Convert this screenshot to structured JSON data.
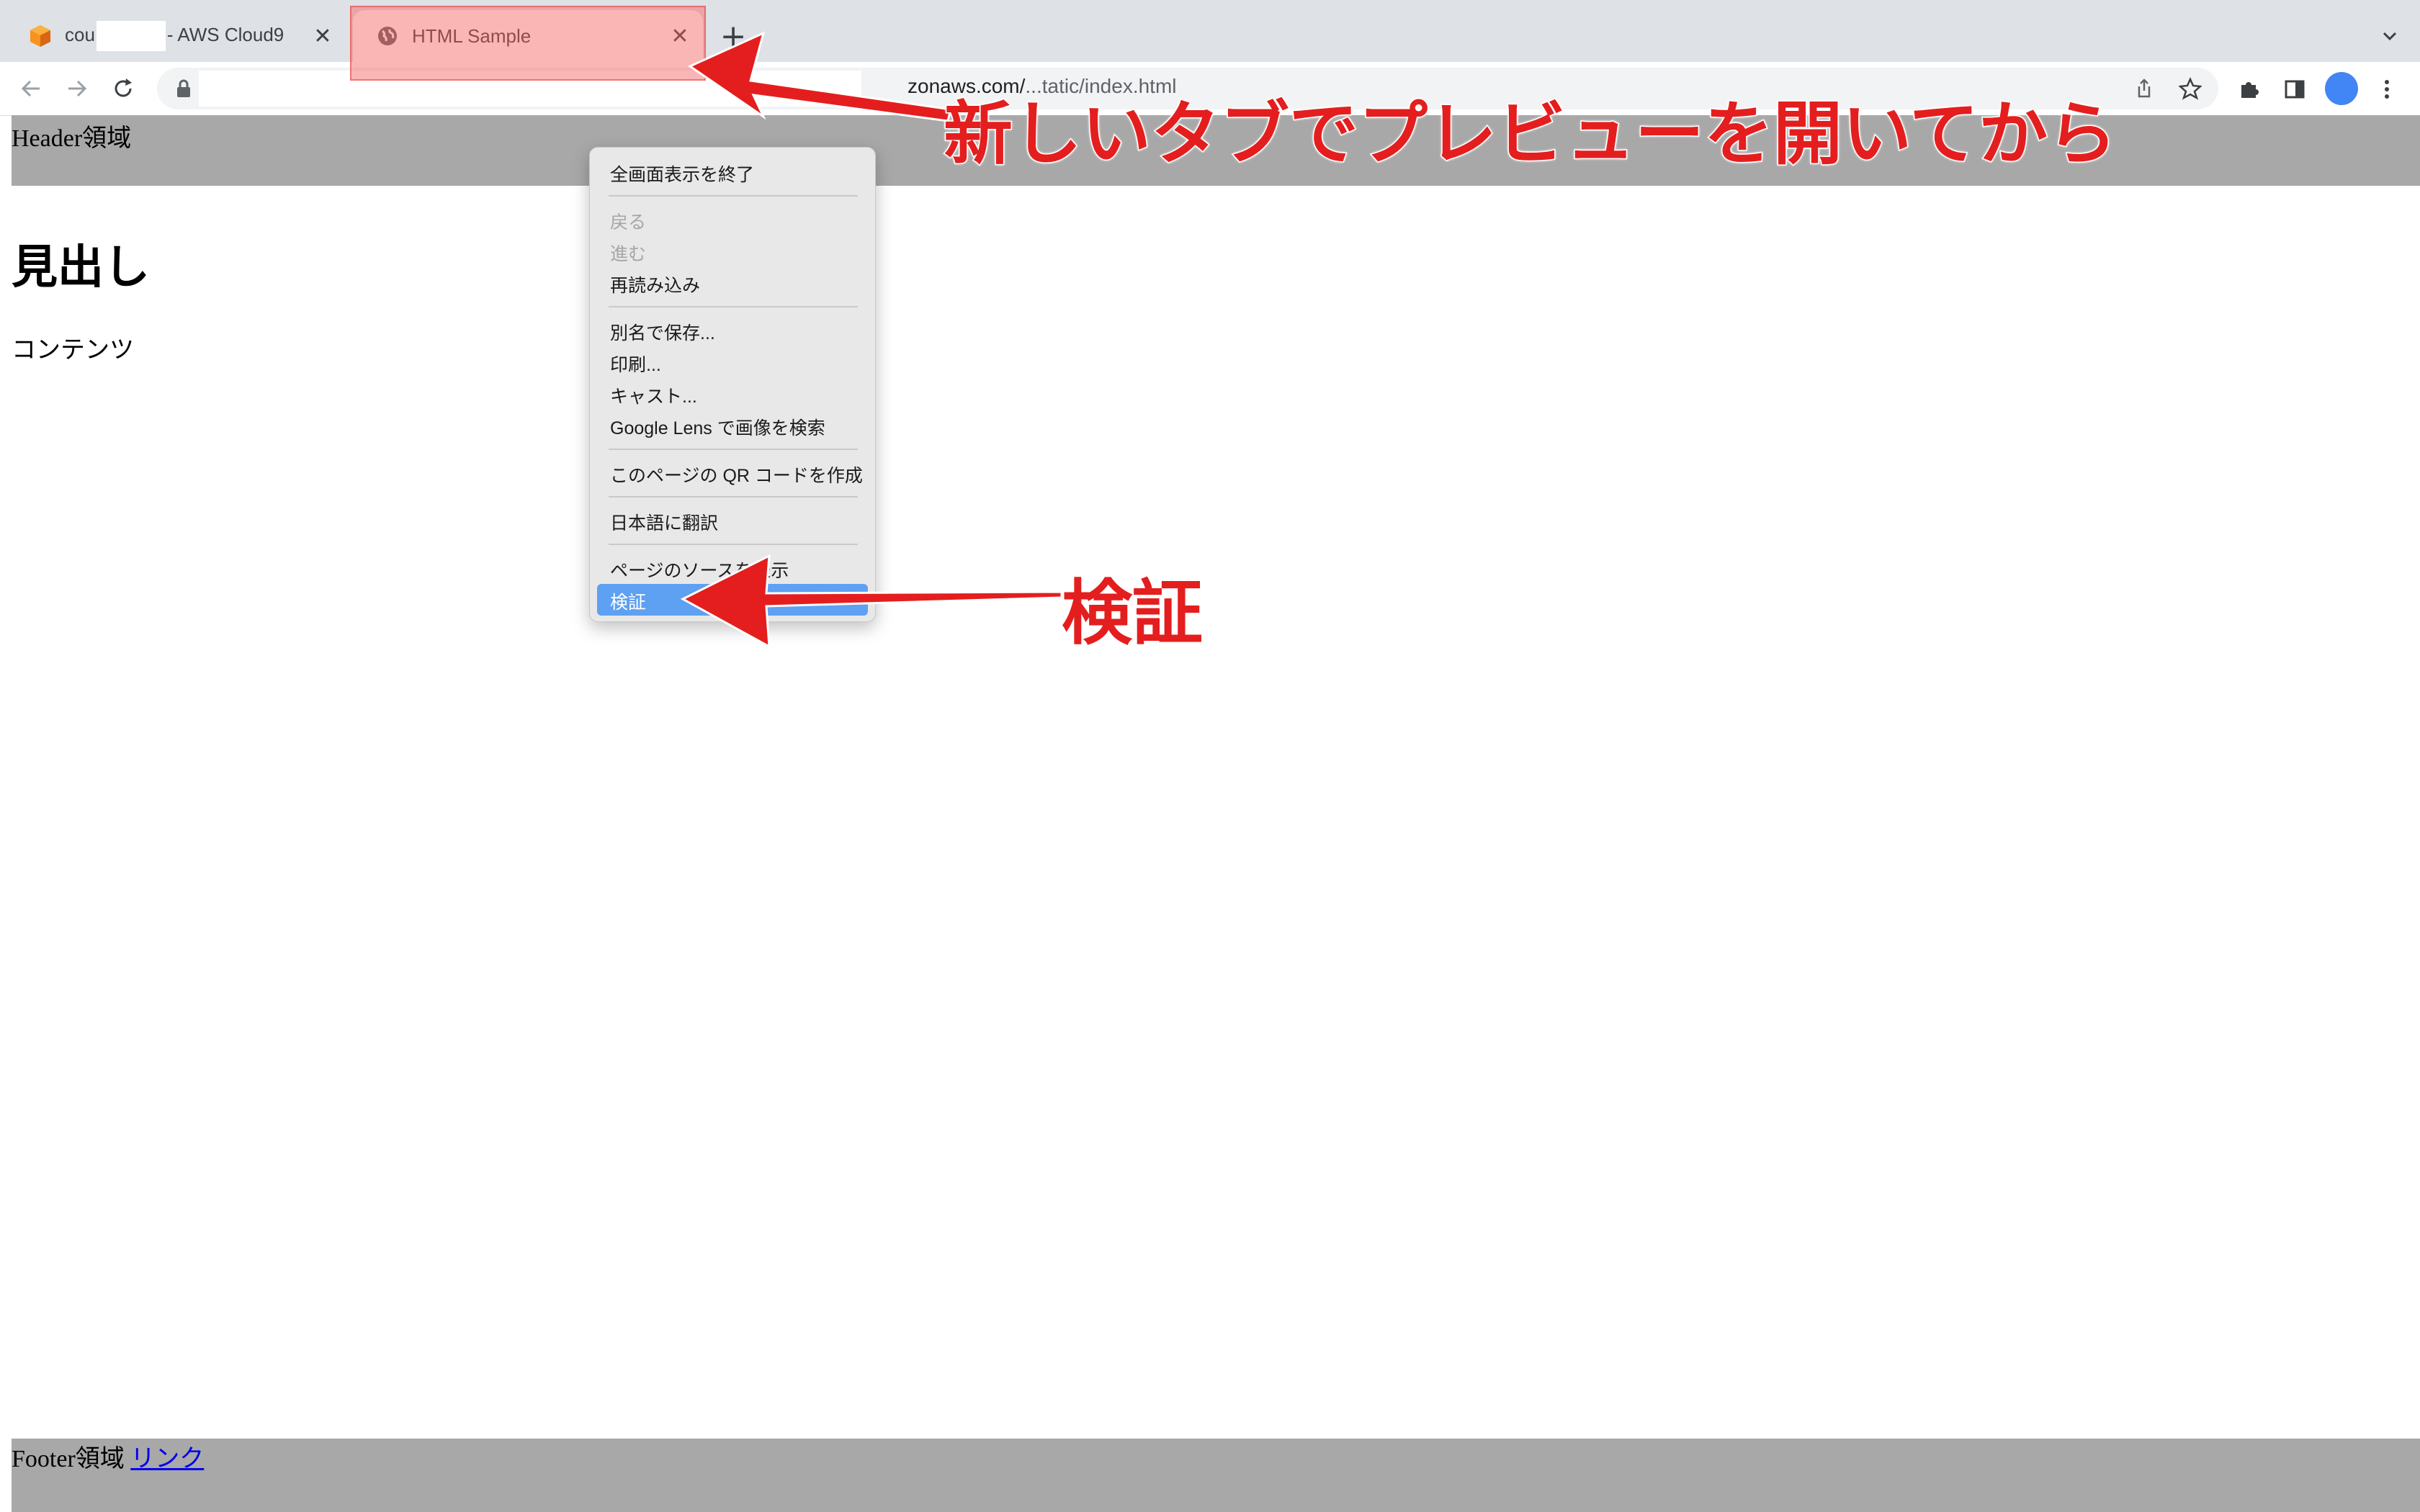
{
  "browser": {
    "tabs": [
      {
        "label_prefix": "cou",
        "label_suffix": "- AWS Cloud9",
        "icon": "cloud9-cube-icon",
        "active": false
      },
      {
        "label": "HTML Sample",
        "icon": "globe-icon",
        "active": true
      }
    ],
    "address_bar": {
      "url_host": "zonaws.com/",
      "url_path": "...tatic/index.html"
    }
  },
  "page": {
    "header_text": "Header領域",
    "heading": "見出し",
    "content": "コンテンツ",
    "footer_text": "Footer領域",
    "footer_link": "リンク"
  },
  "context_menu": {
    "items": {
      "exit_fullscreen": "全画面表示を終了",
      "back": "戻る",
      "forward": "進む",
      "reload": "再読み込み",
      "save_as": "別名で保存...",
      "print": "印刷...",
      "cast": "キャスト...",
      "google_lens": "Google Lens で画像を検索",
      "qr_code": "このページの QR コードを作成",
      "translate": "日本語に翻訳",
      "view_source": "ページのソースを表示",
      "inspect": "検証"
    }
  },
  "annotations": {
    "tab_note": "新しいタブでプレビューを開いてから",
    "inspect_note": "検証"
  },
  "colors": {
    "annotation_red": "#e41e1e",
    "menu_selected": "#5ea0f2",
    "page_band": "#a8a8a8",
    "tab_bar": "#dee1e6"
  }
}
